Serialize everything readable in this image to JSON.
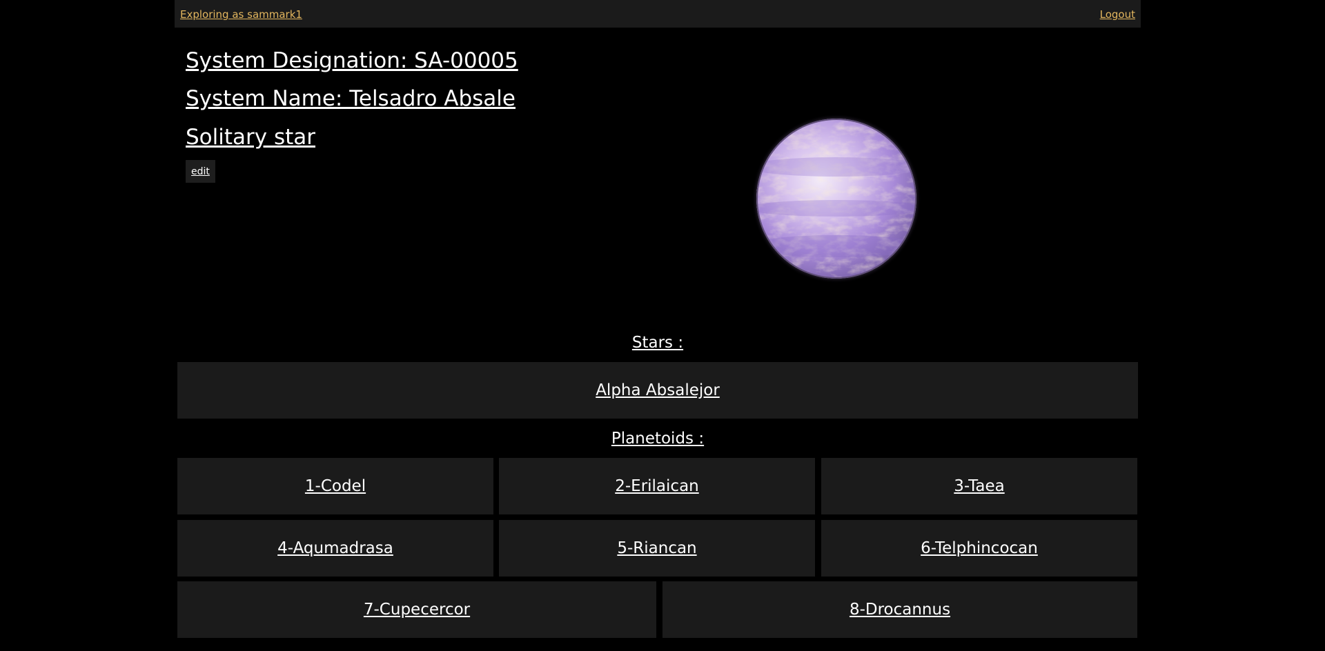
{
  "topbar": {
    "user_link": "Exploring as sammark1",
    "logout_link": "Logout"
  },
  "system": {
    "designation": "System Designation: SA-00005",
    "name": "System Name: Telsadro Absale",
    "type": "Solitary star",
    "edit_label": "edit"
  },
  "stars": {
    "label": "Stars :",
    "items": [
      "Alpha Absalejor"
    ]
  },
  "planetoids": {
    "label": "Planetoids :",
    "items": [
      "1-Codel",
      "2-Erilaican",
      "3-Taea",
      "4-Aqumadrasa",
      "5-Riancan",
      "6-Telphincocan",
      "7-Cupecercor",
      "8-Drocannus"
    ]
  },
  "colors": {
    "background": "#000000",
    "panel": "#1b1b1b",
    "link_accent": "#e3b65e",
    "text": "#ffffff",
    "planet_primary": "#b79de0",
    "planet_secondary": "#f0d9b8"
  },
  "icons": {
    "planet": "planet-sphere-image"
  }
}
